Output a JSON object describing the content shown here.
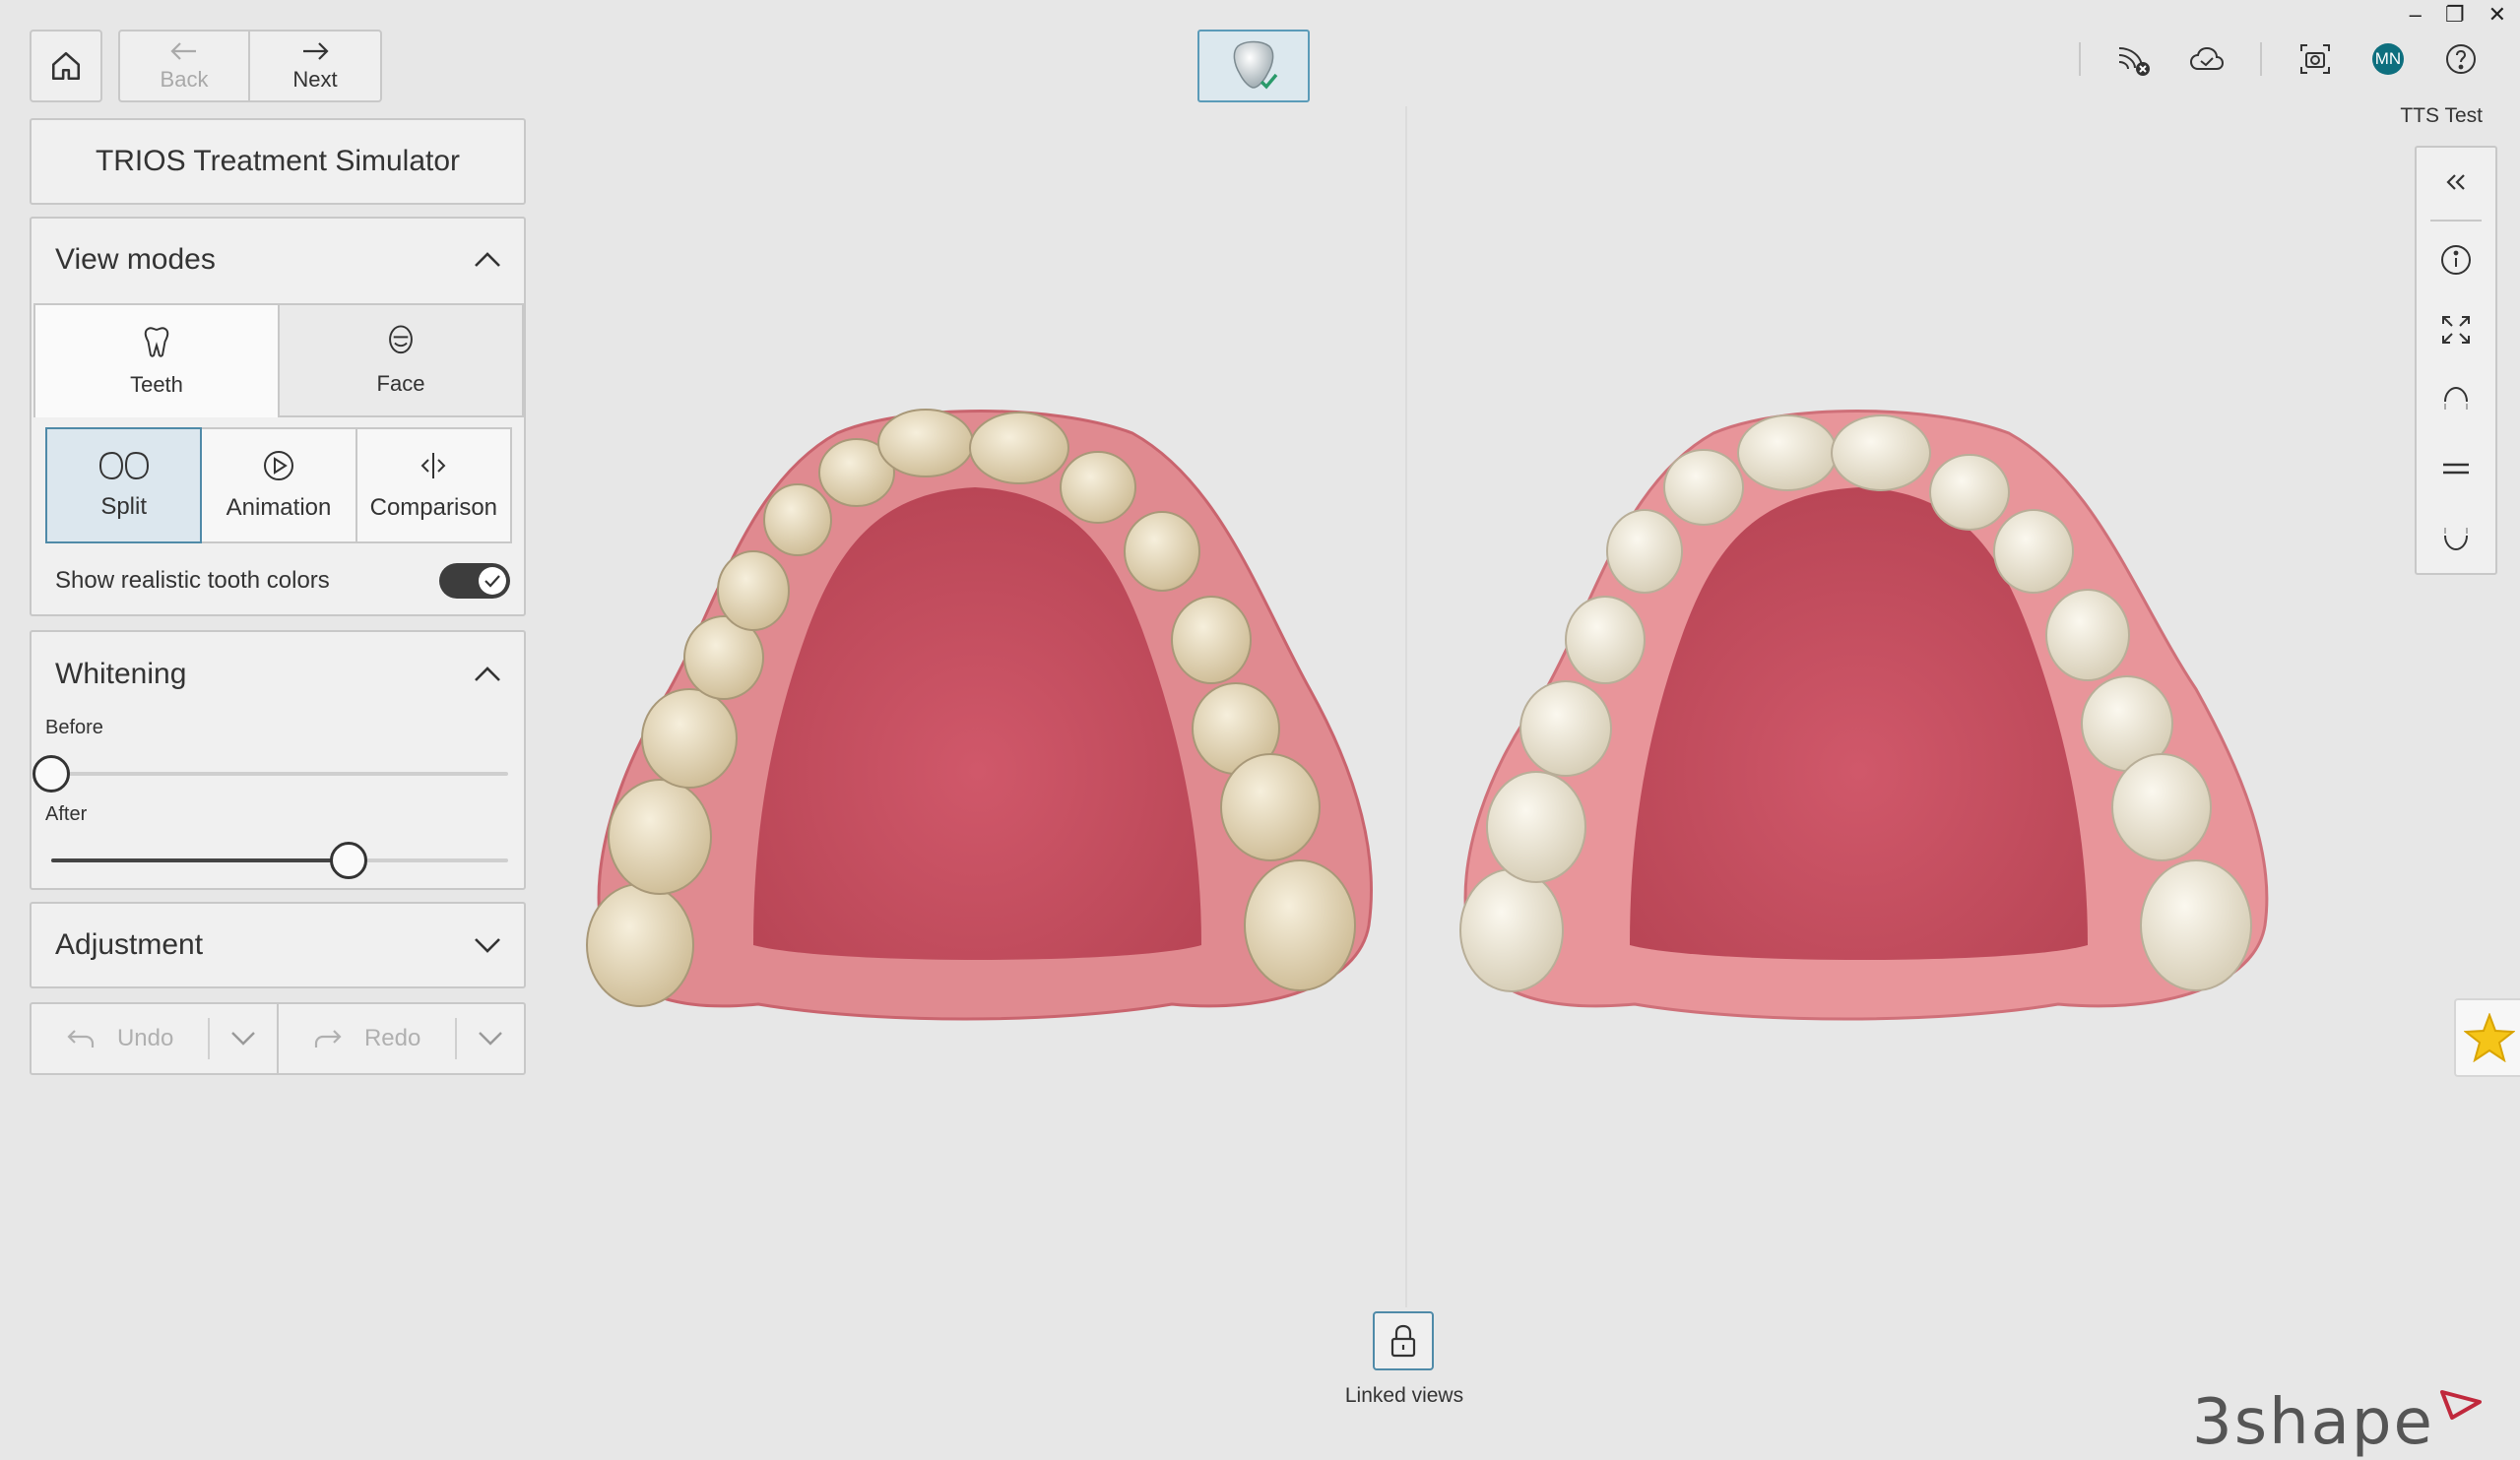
{
  "nav": {
    "back_label": "Back",
    "next_label": "Next"
  },
  "app_title": "TRIOS Treatment Simulator",
  "view_modes": {
    "title": "View modes",
    "tabs": [
      {
        "label": "Teeth",
        "active": true
      },
      {
        "label": "Face",
        "active": false
      }
    ],
    "modes": [
      {
        "label": "Split",
        "active": true
      },
      {
        "label": "Animation",
        "active": false
      },
      {
        "label": "Comparison",
        "active": false
      }
    ],
    "toggle_label": "Show realistic tooth colors",
    "toggle_on": true
  },
  "whitening": {
    "title": "Whitening",
    "before_label": "Before",
    "before_value": 0.0,
    "after_label": "After",
    "after_value": 0.65
  },
  "adjustment": {
    "title": "Adjustment"
  },
  "history": {
    "undo_label": "Undo",
    "redo_label": "Redo"
  },
  "viewport": {
    "linked_label": "Linked views"
  },
  "user": {
    "name": "TTS Test",
    "initials": "MN"
  },
  "brand": {
    "logo_text": "3shape",
    "accent": "#c0283c"
  },
  "colors": {
    "active_mode_bg": "#dce7ee",
    "active_mode_border": "#4f8aa8",
    "gum": "#d9717a",
    "palate": "#c85460",
    "tooth": "#ece2c9"
  },
  "icons": {
    "home": "home-icon",
    "back": "arrow-left-icon",
    "next": "arrow-right-icon",
    "top_right": [
      "no-connection-icon",
      "cloud-icon",
      "screenshot-icon",
      "avatar",
      "help-icon"
    ],
    "tools": [
      "collapse-icon",
      "info-icon",
      "fullscreen-icon",
      "rotate-up-icon",
      "equal-icon",
      "rotate-down-icon"
    ]
  }
}
